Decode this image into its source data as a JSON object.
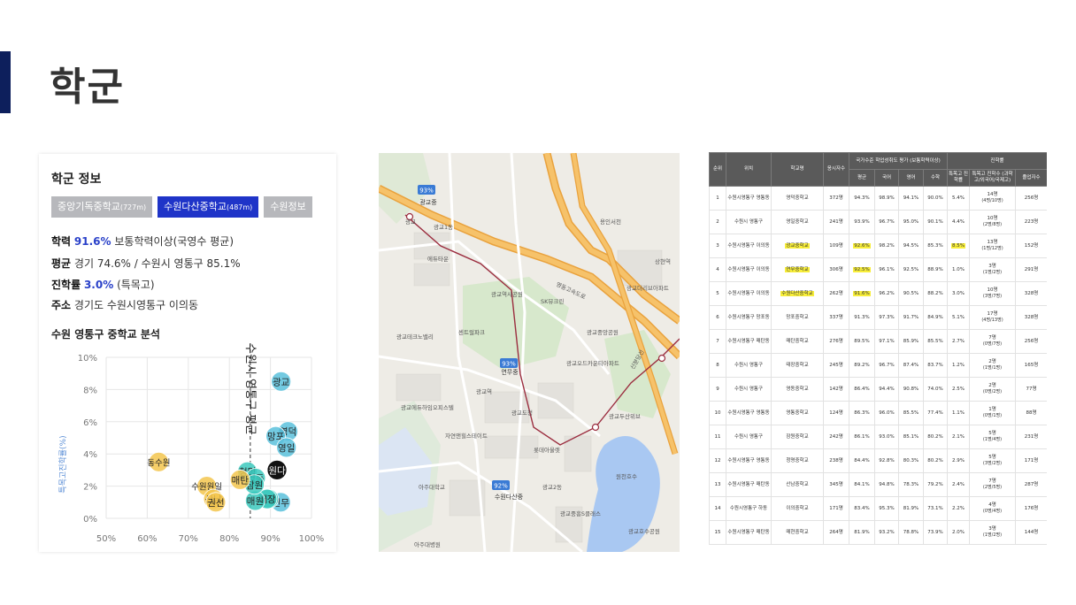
{
  "page": {
    "title": "학군"
  },
  "school_info": {
    "title": "학군 정보",
    "tabs": [
      {
        "label": "중앙기독중학교",
        "distance": "(727m)"
      },
      {
        "label": "수원다산중학교",
        "distance": "(487m)"
      },
      {
        "label": "수원정보",
        "distance": ""
      }
    ],
    "academic": {
      "label": "학력",
      "value": "91.6%",
      "desc": "보통학력이상(국영수 평균)"
    },
    "average": {
      "label": "평균",
      "value": "경기 74.6% / 수원시 영통구 85.1%"
    },
    "advance": {
      "label": "진학률",
      "value": "3.0%",
      "desc": "(특목고)"
    },
    "address": {
      "label": "주소",
      "value": "경기도 수원시영통구 이의동"
    },
    "chart_title": "수원 영통구 중학교 분석"
  },
  "chart_data": {
    "type": "scatter",
    "title": "수원 영통구 중학교 분석",
    "xlabel": "",
    "ylabel": "특목고진학률(%)",
    "xlim": [
      50,
      100
    ],
    "ylim": [
      0,
      10
    ],
    "xticks": [
      "50%",
      "60%",
      "70%",
      "80%",
      "90%",
      "100%"
    ],
    "yticks": [
      "0%",
      "2%",
      "4%",
      "6%",
      "8%",
      "10%"
    ],
    "grid": true,
    "reference_line": {
      "x": 85.1,
      "label": "수원시 영통구 평균"
    },
    "colors": {
      "below": "#f3c64e",
      "above": "#5bc1dc",
      "mid": "#3cc9bd",
      "selected": "#111111"
    },
    "points": [
      {
        "label": "광교",
        "x": 92.6,
        "y": 8.5,
        "group": "above"
      },
      {
        "label": "영덕",
        "x": 94.3,
        "y": 5.4,
        "group": "above"
      },
      {
        "label": "망포",
        "x": 91.3,
        "y": 5.1,
        "group": "above"
      },
      {
        "label": "영일",
        "x": 93.9,
        "y": 4.4,
        "group": "above"
      },
      {
        "label": "원다",
        "x": 91.6,
        "y": 3.0,
        "group": "selected"
      },
      {
        "label": "연무",
        "x": 92.5,
        "y": 1.0,
        "group": "above"
      },
      {
        "label": "영통",
        "x": 89.6,
        "y": 1.2,
        "group": "mid"
      },
      {
        "label": "태장",
        "x": 89.2,
        "y": 1.2,
        "group": "mid"
      },
      {
        "label": "청명",
        "x": 84.4,
        "y": 2.9,
        "group": "mid"
      },
      {
        "label": "영동",
        "x": 86.4,
        "y": 2.5,
        "group": "mid"
      },
      {
        "label": "매원",
        "x": 86.3,
        "y": 1.1,
        "group": "mid"
      },
      {
        "label": "잠원",
        "x": 86.1,
        "y": 2.1,
        "group": "mid"
      },
      {
        "label": "매탄",
        "x": 82.6,
        "y": 2.4,
        "group": "below"
      },
      {
        "label": "동수원",
        "x": 62.8,
        "y": 3.5,
        "group": "below"
      },
      {
        "label": "수원원일",
        "x": 74.5,
        "y": 2.0,
        "group": "below"
      },
      {
        "label": "산남",
        "x": 76.1,
        "y": 1.2,
        "group": "below"
      },
      {
        "label": "권선",
        "x": 76.7,
        "y": 1.0,
        "group": "below"
      }
    ]
  },
  "map": {
    "markers": [
      {
        "label": "광교중",
        "badge": "93%"
      },
      {
        "label": "연무중",
        "badge": "93%"
      },
      {
        "label": "수원다산중",
        "badge": "92%"
      }
    ],
    "place_labels": [
      "광교1동",
      "광교",
      "에듀타운",
      "광교역사공원",
      "SK뷰크린",
      "광교중앙공원",
      "센트럴파크",
      "광교오드카운티아파트",
      "광교테크노밸리",
      "광교역",
      "광교에듀하임오피스텔",
      "아주대학교",
      "자연앤힐스테이트",
      "광교도청",
      "롯데아울렛",
      "광교호수공원",
      "원천호수",
      "광교2동",
      "용인서천",
      "광교더리브아파트",
      "상현역",
      "광교두산위브",
      "광교중흥S클래스",
      "아주대병원",
      "신분당선",
      "영동고속도로"
    ]
  },
  "table": {
    "group_headers": {
      "eval": "국가수준 학업성취도 평가 (보통학력이상)",
      "advance": "진학률"
    },
    "headers": [
      "순위",
      "위치",
      "학교명",
      "응시자수",
      "평균",
      "국어",
      "영어",
      "수학",
      "특목고 진학률",
      "특목고 진학수 (과학고/외국어/국제고)",
      "졸업자수"
    ],
    "rows": [
      {
        "rank": "1",
        "loc": "수원시영통구 영통동",
        "school": "영덕중학교",
        "n": "372명",
        "avg": "94.3%",
        "kor": "98.9%",
        "eng": "94.1%",
        "math": "90.0%",
        "rate": "5.4%",
        "cnt": "14명",
        "cnt2": "(4명/10명)",
        "grad": "256명",
        "hl": []
      },
      {
        "rank": "2",
        "loc": "수원시 영통구",
        "school": "영일중학교",
        "n": "241명",
        "avg": "93.9%",
        "kor": "96.7%",
        "eng": "95.0%",
        "math": "90.1%",
        "rate": "4.4%",
        "cnt": "10명",
        "cnt2": "(2명/8명)",
        "grad": "223명",
        "hl": []
      },
      {
        "rank": "3",
        "loc": "수원시영통구 이의동",
        "school": "광교중학교",
        "n": "109명",
        "avg": "92.6%",
        "kor": "98.2%",
        "eng": "94.5%",
        "math": "85.3%",
        "rate": "8.5%",
        "cnt": "13명",
        "cnt2": "(1명/12명)",
        "grad": "152명",
        "hl": [
          "school",
          "avg",
          "rate"
        ]
      },
      {
        "rank": "4",
        "loc": "수원시영통구 이의동",
        "school": "연무중학교",
        "n": "306명",
        "avg": "92.5%",
        "kor": "96.1%",
        "eng": "92.5%",
        "math": "88.9%",
        "rate": "1.0%",
        "cnt": "3명",
        "cnt2": "(1명/2명)",
        "grad": "291명",
        "hl": [
          "school",
          "avg"
        ]
      },
      {
        "rank": "5",
        "loc": "수원시영통구 이의동",
        "school": "수원다산중학교",
        "n": "262명",
        "avg": "91.6%",
        "kor": "96.2%",
        "eng": "90.5%",
        "math": "88.2%",
        "rate": "3.0%",
        "cnt": "10명",
        "cnt2": "(3명/7명)",
        "grad": "328명",
        "hl": [
          "school",
          "avg"
        ]
      },
      {
        "rank": "6",
        "loc": "수원시영통구 망포동",
        "school": "망포중학교",
        "n": "337명",
        "avg": "91.3%",
        "kor": "97.3%",
        "eng": "91.7%",
        "math": "84.9%",
        "rate": "5.1%",
        "cnt": "17명",
        "cnt2": "(4명/13명)",
        "grad": "328명",
        "hl": []
      },
      {
        "rank": "7",
        "loc": "수원시영통구 매탄동",
        "school": "매탄중학교",
        "n": "276명",
        "avg": "89.5%",
        "kor": "97.1%",
        "eng": "85.9%",
        "math": "85.5%",
        "rate": "2.7%",
        "cnt": "7명",
        "cnt2": "(0명/7명)",
        "grad": "256명",
        "hl": []
      },
      {
        "rank": "8",
        "loc": "수원시 영통구",
        "school": "태장중학교",
        "n": "245명",
        "avg": "89.2%",
        "kor": "96.7%",
        "eng": "87.4%",
        "math": "83.7%",
        "rate": "1.2%",
        "cnt": "2명",
        "cnt2": "(1명/1명)",
        "grad": "165명",
        "hl": []
      },
      {
        "rank": "9",
        "loc": "수원시 영통구",
        "school": "영동중학교",
        "n": "142명",
        "avg": "86.4%",
        "kor": "94.4%",
        "eng": "90.8%",
        "math": "74.0%",
        "rate": "2.5%",
        "cnt": "2명",
        "cnt2": "(0명/2명)",
        "grad": "77명",
        "hl": []
      },
      {
        "rank": "10",
        "loc": "수원시영통구 영통동",
        "school": "영통중학교",
        "n": "124명",
        "avg": "86.3%",
        "kor": "96.0%",
        "eng": "85.5%",
        "math": "77.4%",
        "rate": "1.1%",
        "cnt": "1명",
        "cnt2": "(0명/1명)",
        "grad": "88명",
        "hl": []
      },
      {
        "rank": "11",
        "loc": "수원시 영통구",
        "school": "잠원중학교",
        "n": "242명",
        "avg": "86.1%",
        "kor": "93.0%",
        "eng": "85.1%",
        "math": "80.2%",
        "rate": "2.1%",
        "cnt": "5명",
        "cnt2": "(1명/4명)",
        "grad": "231명",
        "hl": []
      },
      {
        "rank": "12",
        "loc": "수원시영통구 영통동",
        "school": "청명중학교",
        "n": "238명",
        "avg": "84.4%",
        "kor": "92.8%",
        "eng": "80.3%",
        "math": "80.2%",
        "rate": "2.9%",
        "cnt": "5명",
        "cnt2": "(3명/2명)",
        "grad": "171명",
        "hl": []
      },
      {
        "rank": "13",
        "loc": "수원시영통구 매탄동",
        "school": "산남중학교",
        "n": "345명",
        "avg": "84.1%",
        "kor": "94.8%",
        "eng": "78.3%",
        "math": "79.2%",
        "rate": "2.4%",
        "cnt": "7명",
        "cnt2": "(2명/5명)",
        "grad": "287명",
        "hl": []
      },
      {
        "rank": "14",
        "loc": "수원시영통구 하동",
        "school": "이의중학교",
        "n": "171명",
        "avg": "83.4%",
        "kor": "95.3%",
        "eng": "81.9%",
        "math": "73.1%",
        "rate": "2.2%",
        "cnt": "4명",
        "cnt2": "(0명/4명)",
        "grad": "176명",
        "hl": []
      },
      {
        "rank": "15",
        "loc": "수원시영통구 매탄동",
        "school": "매현중학교",
        "n": "264명",
        "avg": "81.9%",
        "kor": "93.2%",
        "eng": "78.8%",
        "math": "73.9%",
        "rate": "2.0%",
        "cnt": "3명",
        "cnt2": "(1명/2명)",
        "grad": "144명",
        "hl": []
      }
    ]
  }
}
